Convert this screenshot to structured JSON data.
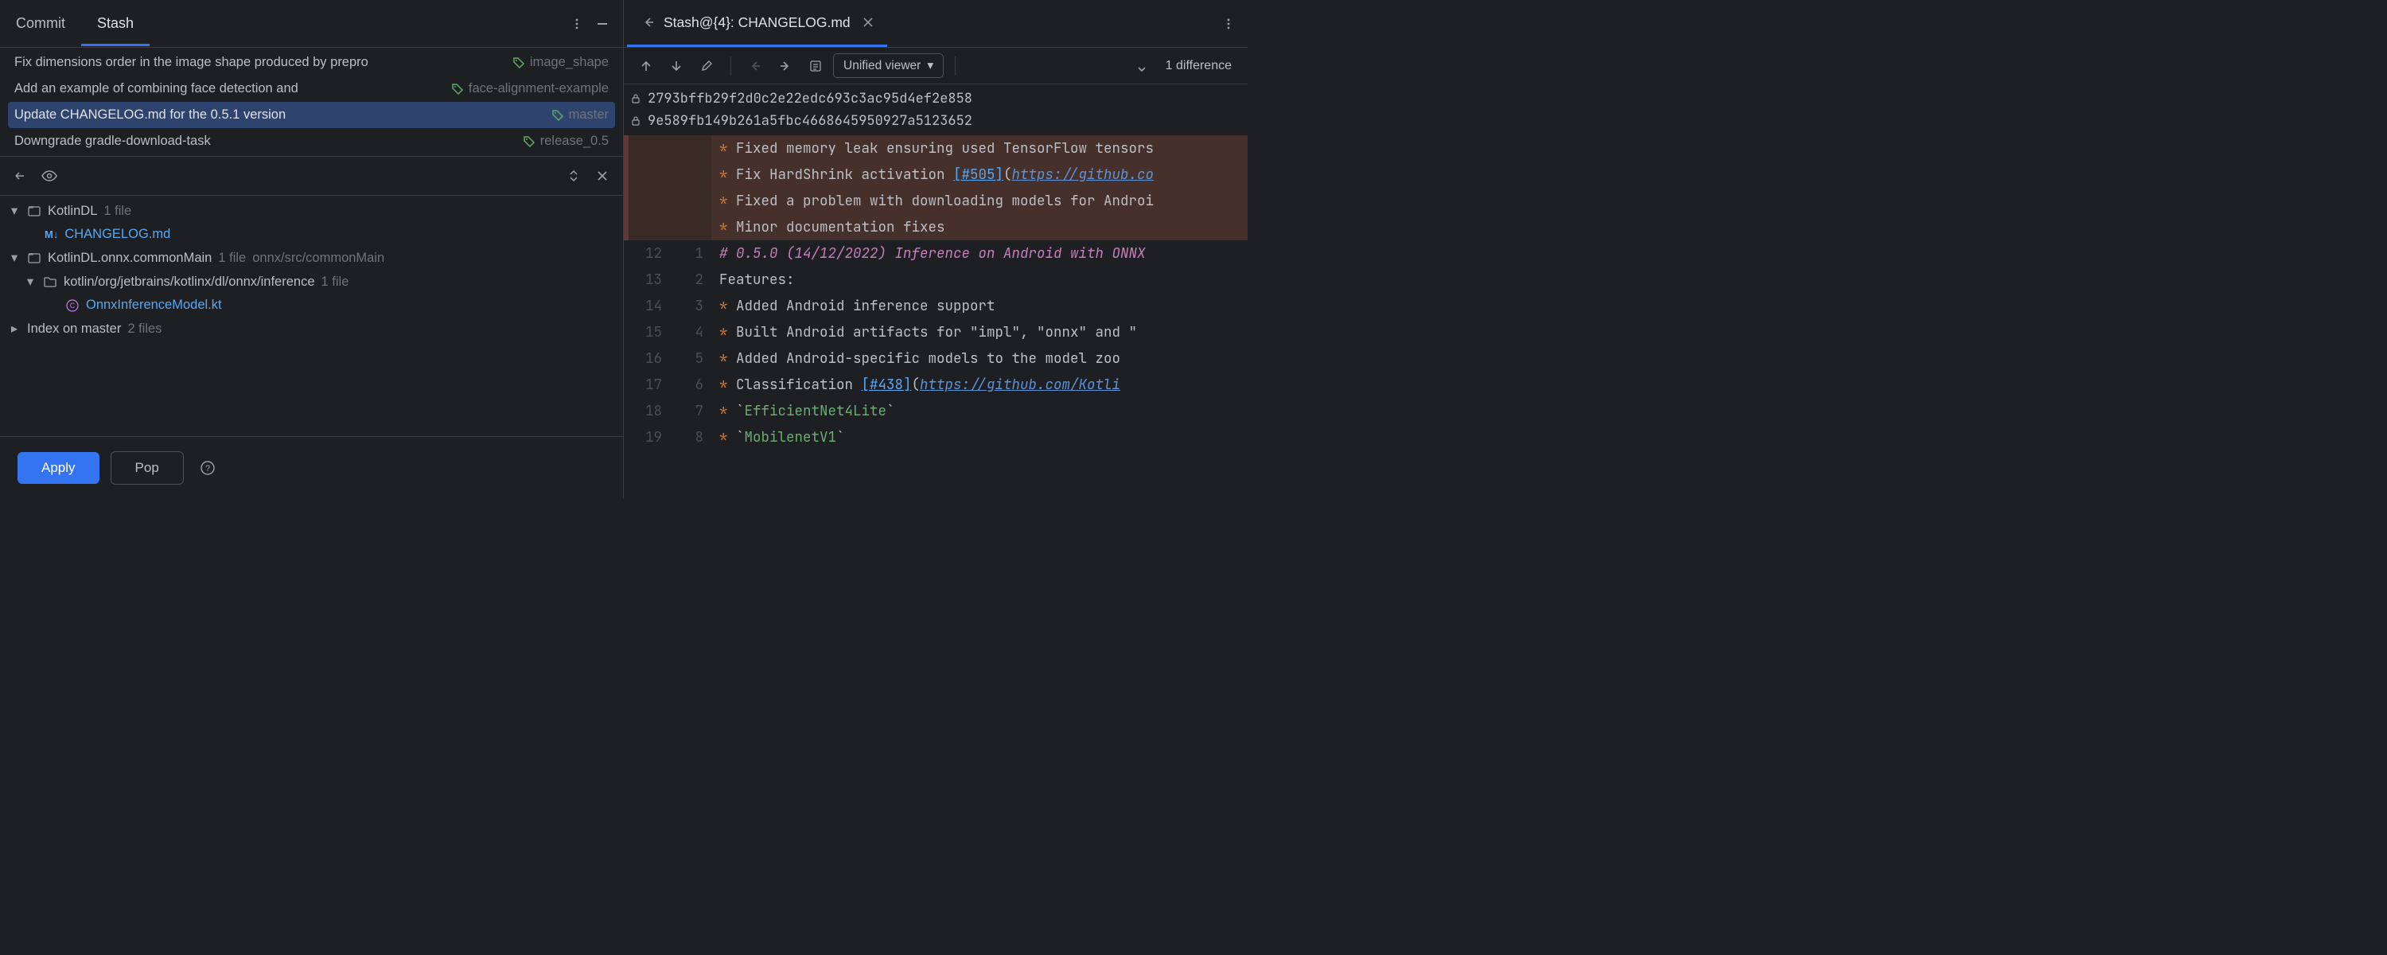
{
  "tabs": {
    "commit": "Commit",
    "stash": "Stash"
  },
  "stashes": [
    {
      "msg": "Fix dimensions order in the image shape produced by prepro",
      "tag": "image_shape"
    },
    {
      "msg": "Add an example of combining face detection and ",
      "tag": "face-alignment-example"
    },
    {
      "msg": "Update CHANGELOG.md for the 0.5.1 version",
      "tag": "master",
      "selected": true
    },
    {
      "msg": "Downgrade gradle-download-task",
      "tag": "release_0.5"
    }
  ],
  "tree": {
    "root1": {
      "name": "KotlinDL",
      "meta": "1 file"
    },
    "file1": {
      "name": "CHANGELOG.md"
    },
    "root2": {
      "name": "KotlinDL.onnx.commonMain",
      "meta": "1 file",
      "path": "onnx/src/commonMain"
    },
    "sub2": {
      "name": "kotlin/org/jetbrains/kotlinx/dl/onnx/inference",
      "meta": "1 file"
    },
    "file2": {
      "name": "OnnxInferenceModel.kt"
    },
    "root3": {
      "name": "Index on master",
      "meta": "2 files"
    }
  },
  "buttons": {
    "apply": "Apply",
    "pop": "Pop"
  },
  "right": {
    "tab_title": "Stash@{4}: CHANGELOG.md",
    "viewer_mode": "Unified viewer",
    "diff_count": "1 difference",
    "hash_a": "2793bffb29f2d0c2e22edc693c3ac95d4ef2e858",
    "hash_b": "9e589fb149b261a5fbc4668645950927a5123652"
  },
  "code": {
    "l1": "* Fixed memory leak ensuring used TensorFlow tensors",
    "l2a": "* Fix HardShrink activation ",
    "l2b": "[#505]",
    "l2c": "https://github.co",
    "l3": "* Fixed a problem with downloading models for Androi",
    "l4": "* Minor documentation fixes",
    "l5": "# 0.5.0 (14/12/2022) Inference on Android with ONNX",
    "l6": "Features:",
    "l7": "* Added Android inference support",
    "l8": "  * Built Android artifacts for \"impl\", \"onnx\" and \"",
    "l9": "  * Added Android-specific models to the model zoo",
    "l10a": "    * Classification ",
    "l10b": "[#438]",
    "l10c": "https://github.com/Kotli",
    "l11a": "      * `",
    "l11b": "EfficientNet4Lite",
    "l11c": "`",
    "l12a": "      * `",
    "l12b": "MobilenetV1",
    "l12c": "`"
  },
  "line_numbers": {
    "new": [
      "",
      "",
      "",
      "",
      "",
      "12",
      "13",
      "14",
      "15",
      "16",
      "17",
      "18",
      "19"
    ],
    "old": [
      "",
      "",
      "",
      "",
      "",
      "1",
      "2",
      "3",
      "4",
      "5",
      "6",
      "7",
      "8"
    ]
  }
}
